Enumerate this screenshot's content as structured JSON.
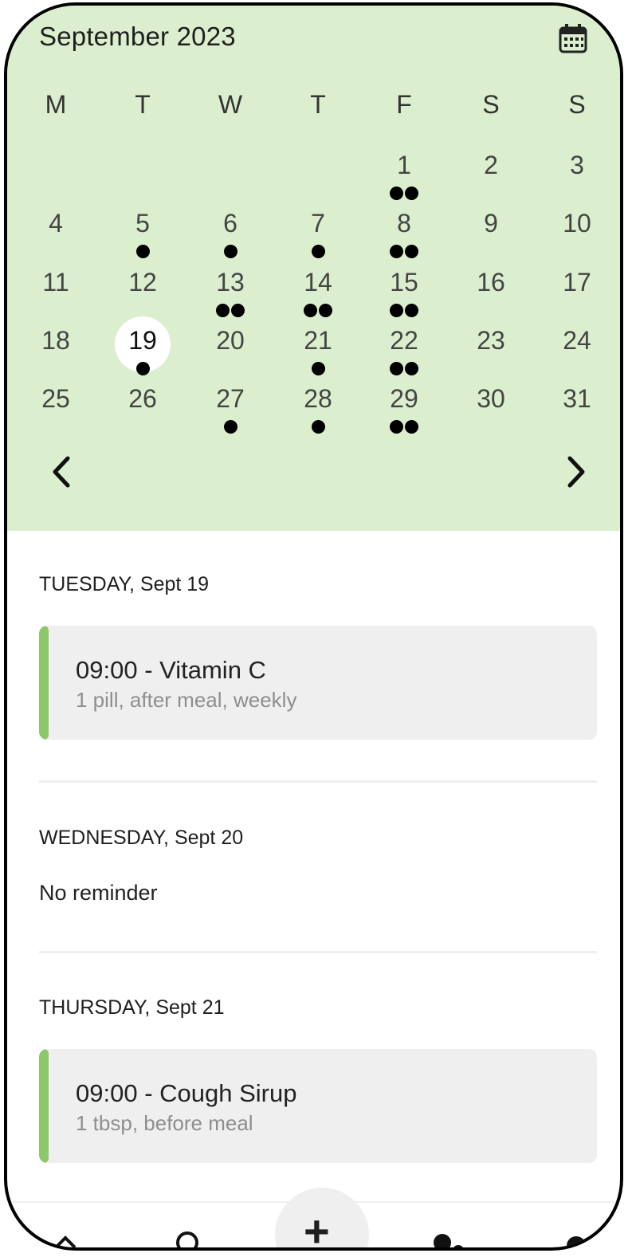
{
  "calendar": {
    "month_title": "September 2023",
    "weekdays": [
      "M",
      "T",
      "W",
      "T",
      "F",
      "S",
      "S"
    ],
    "today": "19",
    "days": [
      {
        "n": "1",
        "d": 2
      },
      {
        "n": "2",
        "d": 0
      },
      {
        "n": "3",
        "d": 0
      },
      {
        "n": "4",
        "d": 0
      },
      {
        "n": "5",
        "d": 1
      },
      {
        "n": "6",
        "d": 1
      },
      {
        "n": "7",
        "d": 1
      },
      {
        "n": "8",
        "d": 2
      },
      {
        "n": "9",
        "d": 0
      },
      {
        "n": "10",
        "d": 0
      },
      {
        "n": "11",
        "d": 0
      },
      {
        "n": "12",
        "d": 0
      },
      {
        "n": "13",
        "d": 2
      },
      {
        "n": "14",
        "d": 2
      },
      {
        "n": "15",
        "d": 2
      },
      {
        "n": "16",
        "d": 0
      },
      {
        "n": "17",
        "d": 0
      },
      {
        "n": "18",
        "d": 0
      },
      {
        "n": "19",
        "d": 1
      },
      {
        "n": "20",
        "d": 0
      },
      {
        "n": "21",
        "d": 1
      },
      {
        "n": "22",
        "d": 2
      },
      {
        "n": "23",
        "d": 0
      },
      {
        "n": "24",
        "d": 0
      },
      {
        "n": "25",
        "d": 0
      },
      {
        "n": "26",
        "d": 0
      },
      {
        "n": "27",
        "d": 1
      },
      {
        "n": "28",
        "d": 1
      },
      {
        "n": "29",
        "d": 2
      },
      {
        "n": "30",
        "d": 0
      },
      {
        "n": "31",
        "d": 0
      }
    ],
    "first_weekday_index": 4,
    "prev_icon": "chevron-left-icon",
    "next_icon": "chevron-right-icon",
    "calendar_icon": "calendar-icon"
  },
  "schedule": [
    {
      "heading": "TUESDAY, Sept 19",
      "title": "09:00 - Vitamin C",
      "detail": "1 pill, after meal, weekly"
    },
    {
      "heading": "WEDNESDAY, Sept 20",
      "empty_text": "No reminder"
    },
    {
      "heading": "THURSDAY, Sept 21",
      "title": "09:00 - Cough Sirup",
      "detail": "1 tbsp, before meal"
    }
  ],
  "colors": {
    "calendar_bg": "#dbefcf",
    "accent_bar": "#8cc86b",
    "card_bg": "#efefef"
  },
  "bottom_nav": {
    "add_icon": "plus-icon",
    "add_label": "+"
  }
}
